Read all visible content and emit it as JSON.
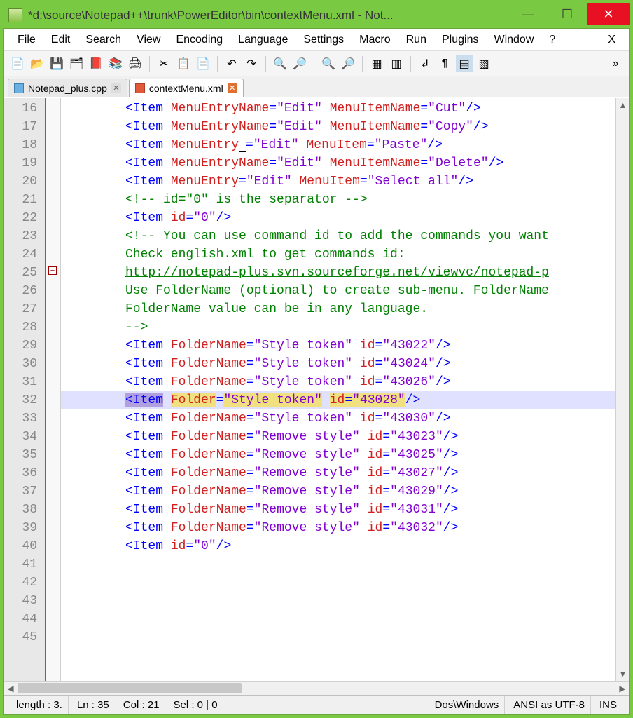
{
  "title": "*d:\\source\\Notepad++\\trunk\\PowerEditor\\bin\\contextMenu.xml - Not...",
  "menu": [
    "File",
    "Edit",
    "Search",
    "View",
    "Encoding",
    "Language",
    "Settings",
    "Macro",
    "Run",
    "Plugins",
    "Window",
    "?",
    "X"
  ],
  "tabs": [
    {
      "label": "Notepad_plus.cpp",
      "active": false,
      "icon": "blue"
    },
    {
      "label": "contextMenu.xml",
      "active": true,
      "icon": "red"
    }
  ],
  "lines": [
    16,
    17,
    18,
    19,
    20,
    21,
    22,
    23,
    24,
    25,
    26,
    27,
    28,
    29,
    30,
    31,
    32,
    33,
    34,
    35,
    36,
    37,
    38,
    39,
    40,
    41,
    42,
    43,
    44,
    45
  ],
  "code": {
    "l16": {
      "tag": "Item",
      "a1": "MenuEntryName",
      "v1": "Edit",
      "a2": "MenuItemName",
      "v2": "Cut"
    },
    "l17": {
      "tag": "Item",
      "a1": "MenuEntryName",
      "v1": "Edit",
      "a2": "MenuItemName",
      "v2": "Copy"
    },
    "l18": {
      "tag": "Item",
      "a1": "MenuEntry",
      "v1": "Edit",
      "a2": "MenuItem",
      "v2": "Paste"
    },
    "l19": {
      "tag": "Item",
      "a1": "MenuEntryName",
      "v1": "Edit",
      "a2": "MenuItemName",
      "v2": "Delete"
    },
    "l20": {
      "tag": "Item",
      "a1": "MenuEntry",
      "v1": "Edit",
      "a2": "MenuItem",
      "v2": "Select all"
    },
    "l22": "<!-- id=\"0\" is the separator -->",
    "l23": {
      "tag": "Item",
      "a1": "id",
      "v1": "0"
    },
    "l25": "<!-- You can use command id to add the commands you want",
    "l26": "Check english.xml to get commands id:",
    "l27": "http://notepad-plus.svn.sourceforge.net/viewvc/notepad-p",
    "l29": "Use FolderName (optional) to create sub-menu. FolderName",
    "l30": "FolderName value can be in any language.",
    "l31": "-->",
    "l32": {
      "tag": "Item",
      "a1": "FolderName",
      "v1": "Style token",
      "a2": "id",
      "v2": "43022"
    },
    "l33": {
      "tag": "Item",
      "a1": "FolderName",
      "v1": "Style token",
      "a2": "id",
      "v2": "43024"
    },
    "l34": {
      "tag": "Item",
      "a1": "FolderName",
      "v1": "Style token",
      "a2": "id",
      "v2": "43026"
    },
    "l35": {
      "tag": "Item",
      "a1": "Folder",
      "v1": "Style token",
      "a2": "id",
      "v2": "43028"
    },
    "l36": {
      "tag": "Item",
      "a1": "FolderName",
      "v1": "Style token",
      "a2": "id",
      "v2": "43030"
    },
    "l38": {
      "tag": "Item",
      "a1": "FolderName",
      "v1": "Remove style",
      "a2": "id",
      "v2": "43023"
    },
    "l39": {
      "tag": "Item",
      "a1": "FolderName",
      "v1": "Remove style",
      "a2": "id",
      "v2": "43025"
    },
    "l40": {
      "tag": "Item",
      "a1": "FolderName",
      "v1": "Remove style",
      "a2": "id",
      "v2": "43027"
    },
    "l41": {
      "tag": "Item",
      "a1": "FolderName",
      "v1": "Remove style",
      "a2": "id",
      "v2": "43029"
    },
    "l42": {
      "tag": "Item",
      "a1": "FolderName",
      "v1": "Remove style",
      "a2": "id",
      "v2": "43031"
    },
    "l43": {
      "tag": "Item",
      "a1": "FolderName",
      "v1": "Remove style",
      "a2": "id",
      "v2": "43032"
    },
    "l44": {
      "tag": "Item",
      "a1": "id",
      "v1": "0"
    }
  },
  "status": {
    "length": "length : 3.",
    "ln": "Ln : 35",
    "col": "Col : 21",
    "sel": "Sel : 0 | 0",
    "eol": "Dos\\Windows",
    "enc": "ANSI as UTF-8",
    "ins": "INS"
  }
}
